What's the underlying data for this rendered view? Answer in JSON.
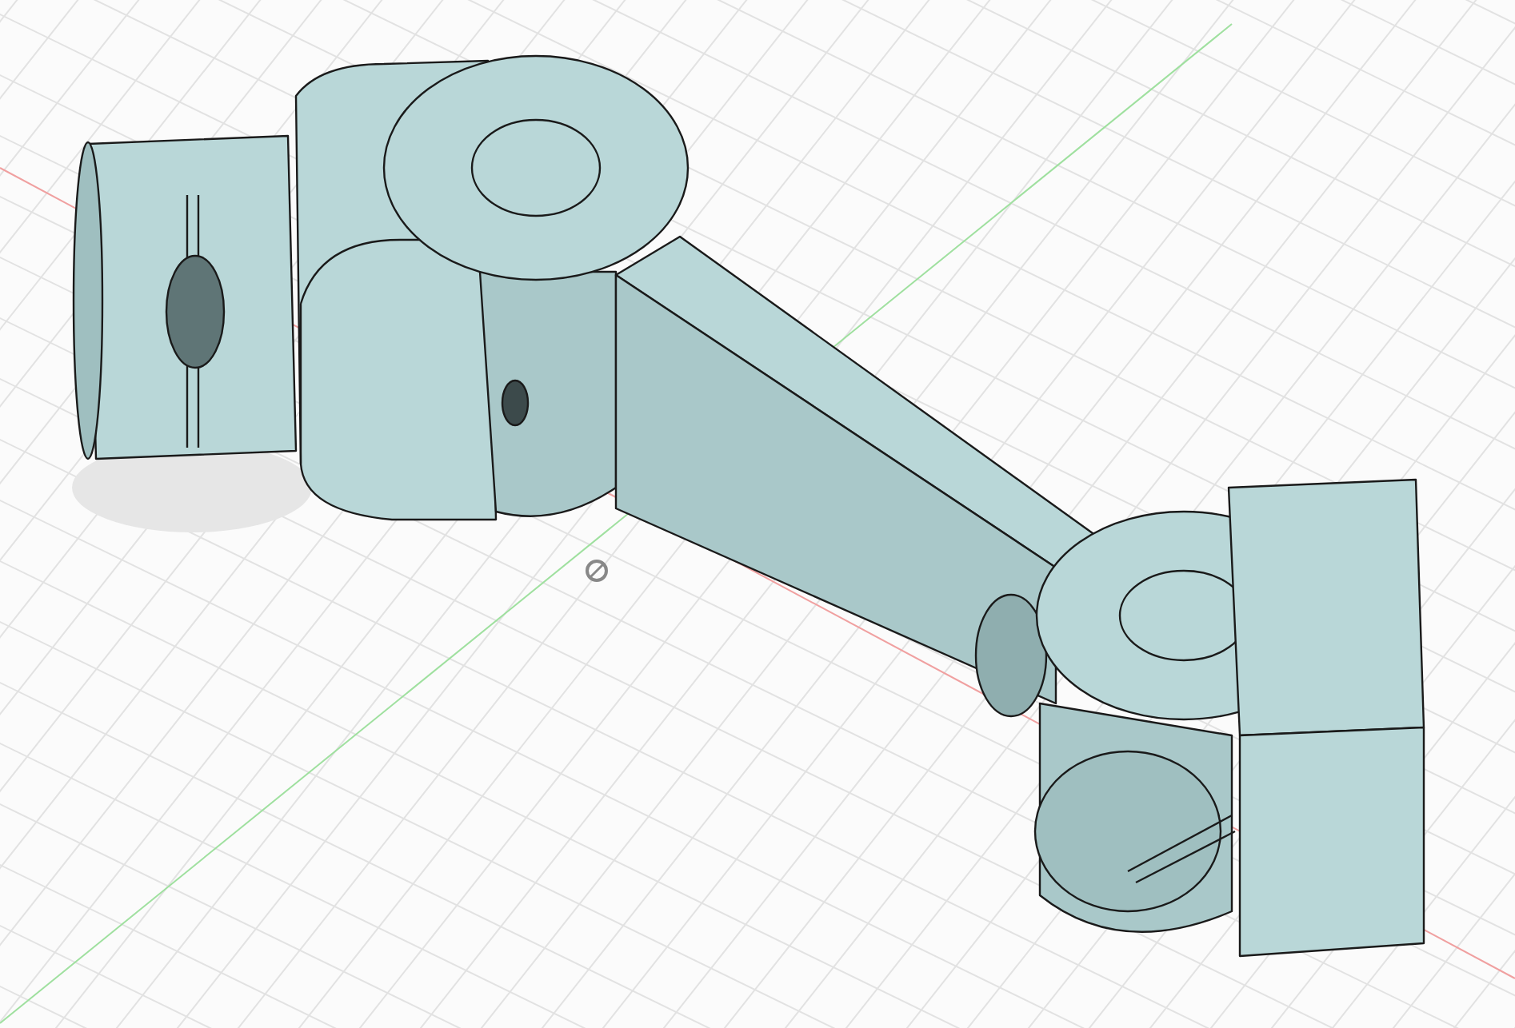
{
  "viewport": {
    "kind": "cad-model",
    "grid": true,
    "origin_marker": true
  }
}
